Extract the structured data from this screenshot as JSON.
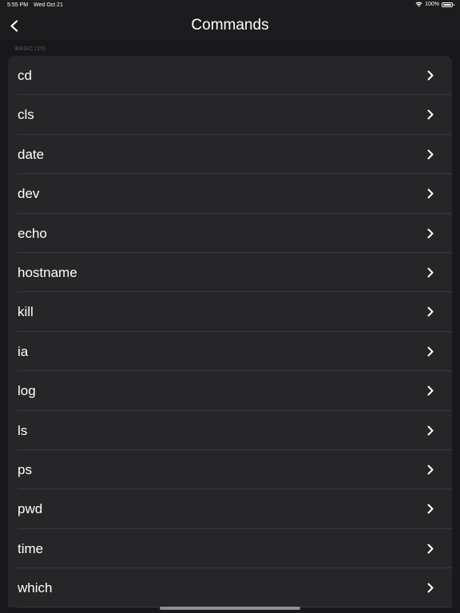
{
  "status_bar": {
    "time": "5:55 PM",
    "date": "Wed Oct 21",
    "battery_text": "100%",
    "icons": [
      "wifi-icon",
      "battery-icon"
    ]
  },
  "nav": {
    "title": "Commands",
    "back_icon": "chevron-left-icon"
  },
  "section": {
    "header": "BASIC (15)"
  },
  "commands": [
    {
      "label": "cd"
    },
    {
      "label": "cls"
    },
    {
      "label": "date"
    },
    {
      "label": "dev"
    },
    {
      "label": "echo"
    },
    {
      "label": "hostname"
    },
    {
      "label": "kill"
    },
    {
      "label": "ia"
    },
    {
      "label": "log"
    },
    {
      "label": "ls"
    },
    {
      "label": "ps"
    },
    {
      "label": "pwd"
    },
    {
      "label": "time"
    },
    {
      "label": "which"
    }
  ],
  "row_icon": "chevron-right-icon",
  "colors": {
    "background": "#1c1c1e",
    "list_background": "#262628",
    "separator": "#3a3a3c",
    "section_header": "#5e5e63",
    "text": "#ffffff"
  }
}
